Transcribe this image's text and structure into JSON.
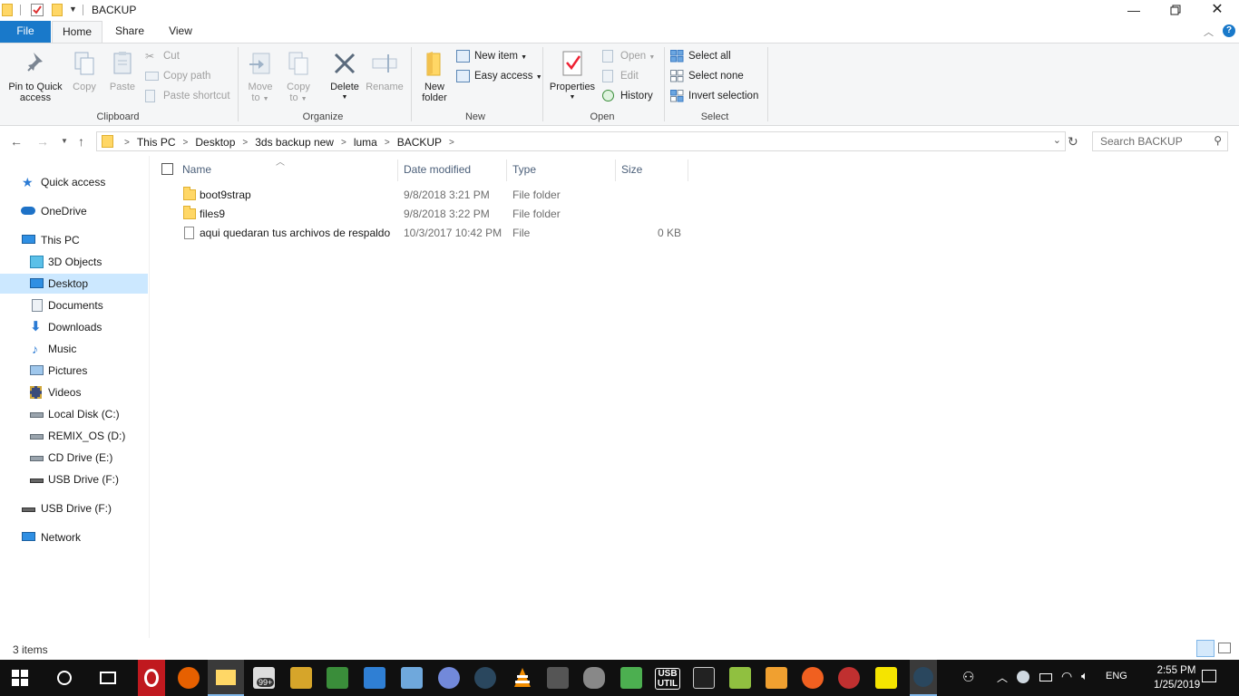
{
  "window": {
    "title": "BACKUP"
  },
  "ribbon_tabs": {
    "file": "File",
    "home": "Home",
    "share": "Share",
    "view": "View"
  },
  "clipboard": {
    "group_label": "Clipboard",
    "pin": "Pin to Quick access",
    "pin_line1": "Pin to Quick",
    "pin_line2": "access",
    "copy": "Copy",
    "paste": "Paste",
    "cut": "Cut",
    "copy_path": "Copy path",
    "paste_shortcut": "Paste shortcut"
  },
  "organize": {
    "group_label": "Organize",
    "move_to_1": "Move",
    "move_to_2": "to",
    "copy_to_1": "Copy",
    "copy_to_2": "to",
    "delete": "Delete",
    "rename": "Rename"
  },
  "new_group": {
    "group_label": "New",
    "new_folder_1": "New",
    "new_folder_2": "folder",
    "new_item": "New item",
    "easy_access": "Easy access"
  },
  "open_group": {
    "group_label": "Open",
    "properties": "Properties",
    "open": "Open",
    "edit": "Edit",
    "history": "History"
  },
  "select_group": {
    "group_label": "Select",
    "select_all": "Select all",
    "select_none": "Select none",
    "invert_selection": "Invert selection"
  },
  "address": {
    "crumbs": [
      "This PC",
      "Desktop",
      "3ds backup new",
      "luma",
      "BACKUP"
    ],
    "search_placeholder": "Search BACKUP"
  },
  "nav": {
    "quick_access": "Quick access",
    "onedrive": "OneDrive",
    "this_pc": "This PC",
    "objects3d": "3D Objects",
    "desktop": "Desktop",
    "documents": "Documents",
    "downloads": "Downloads",
    "music": "Music",
    "pictures": "Pictures",
    "videos": "Videos",
    "local_disk": "Local Disk (C:)",
    "remix": "REMIX_OS (D:)",
    "cd_drive": "CD Drive (E:)",
    "usb_sub": "USB Drive (F:)",
    "usb_top": "USB Drive (F:)",
    "network": "Network"
  },
  "columns": {
    "name": "Name",
    "date": "Date modified",
    "type": "Type",
    "size": "Size"
  },
  "files": [
    {
      "name": "boot9strap",
      "date": "9/8/2018 3:21 PM",
      "type": "File folder",
      "size": ""
    },
    {
      "name": "files9",
      "date": "9/8/2018 3:22 PM",
      "type": "File folder",
      "size": ""
    },
    {
      "name": "aqui quedaran tus archivos de respaldo",
      "date": "10/3/2017 10:42 PM",
      "type": "File",
      "size": "0 KB"
    }
  ],
  "status": {
    "items": "3 items"
  },
  "taskbar": {
    "badge": "99+",
    "usb_util_1": "USB",
    "usb_util_2": "UTIL",
    "lang": "ENG",
    "time": "2:55 PM",
    "date": "1/25/2019"
  },
  "colors": {
    "file_tab": "#1979ca",
    "selection": "#cce8ff",
    "taskbar": "#101010",
    "folder": "#ffd766"
  }
}
